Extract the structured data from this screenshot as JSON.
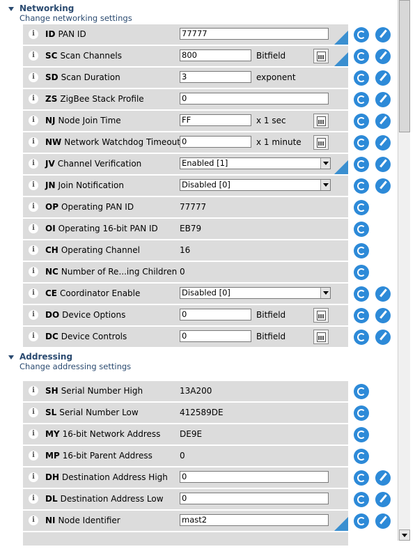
{
  "networking": {
    "title": "Networking",
    "subtitle": "Change networking settings",
    "rows": [
      {
        "code": "ID",
        "label": "PAN ID",
        "kind": "input",
        "value": "77777",
        "modified": true,
        "write": true
      },
      {
        "code": "SC",
        "label": "Scan Channels",
        "kind": "input-short",
        "value": "800",
        "suffix": "Bitfield",
        "calc": true,
        "modified": true,
        "write": true
      },
      {
        "code": "SD",
        "label": "Scan Duration",
        "kind": "input-short",
        "value": "3",
        "suffix": "exponent",
        "write": true
      },
      {
        "code": "ZS",
        "label": "ZigBee Stack Profile",
        "kind": "input",
        "value": "0",
        "write": true
      },
      {
        "code": "NJ",
        "label": "Node Join Time",
        "kind": "input-short",
        "value": "FF",
        "suffix": "x 1 sec",
        "calc": true,
        "write": true
      },
      {
        "code": "NW",
        "label": "Network Watchdog Timeout",
        "kind": "input-short",
        "value": "0",
        "suffix": "x 1 minute",
        "calc": true,
        "write": true
      },
      {
        "code": "JV",
        "label": "Channel Verification",
        "kind": "select",
        "value": "Enabled [1]",
        "modified": true,
        "write": true
      },
      {
        "code": "JN",
        "label": "Join Notification",
        "kind": "select",
        "value": "Disabled [0]",
        "write": true
      },
      {
        "code": "OP",
        "label": "Operating PAN ID",
        "kind": "readonly",
        "value": "77777",
        "write": false
      },
      {
        "code": "OI",
        "label": "Operating 16-bit PAN ID",
        "kind": "readonly",
        "value": "EB79",
        "write": false
      },
      {
        "code": "CH",
        "label": "Operating Channel",
        "kind": "readonly",
        "value": "16",
        "write": false
      },
      {
        "code": "NC",
        "label": "Number of Re...ing Children",
        "kind": "readonly",
        "value": "0",
        "write": false
      },
      {
        "code": "CE",
        "label": "Coordinator Enable",
        "kind": "select",
        "value": "Disabled [0]",
        "write": true
      },
      {
        "code": "DO",
        "label": "Device Options",
        "kind": "input-short",
        "value": "0",
        "suffix": "Bitfield",
        "calc": true,
        "write": true
      },
      {
        "code": "DC",
        "label": "Device Controls",
        "kind": "input-short",
        "value": "0",
        "suffix": "Bitfield",
        "calc": true,
        "write": true
      }
    ]
  },
  "addressing": {
    "title": "Addressing",
    "subtitle": "Change addressing settings",
    "rows": [
      {
        "code": "SH",
        "label": "Serial Number High",
        "kind": "readonly",
        "value": "13A200",
        "write": false
      },
      {
        "code": "SL",
        "label": "Serial Number Low",
        "kind": "readonly",
        "value": "412589DE",
        "write": false
      },
      {
        "code": "MY",
        "label": "16-bit Network Address",
        "kind": "readonly",
        "value": "DE9E",
        "write": false
      },
      {
        "code": "MP",
        "label": "16-bit Parent Address",
        "kind": "readonly",
        "value": "0",
        "write": false
      },
      {
        "code": "DH",
        "label": "Destination Address High",
        "kind": "input",
        "value": "0",
        "write": true
      },
      {
        "code": "DL",
        "label": "Destination Address Low",
        "kind": "input",
        "value": "0",
        "write": true
      },
      {
        "code": "NI",
        "label": "Node Identifier",
        "kind": "input",
        "value": "mast2",
        "modified": true,
        "write": true
      }
    ]
  },
  "info_glyph": "i",
  "icons": {
    "info": "info-icon",
    "refresh": "refresh-icon",
    "write": "write-icon",
    "calculator": "calculator-icon"
  }
}
